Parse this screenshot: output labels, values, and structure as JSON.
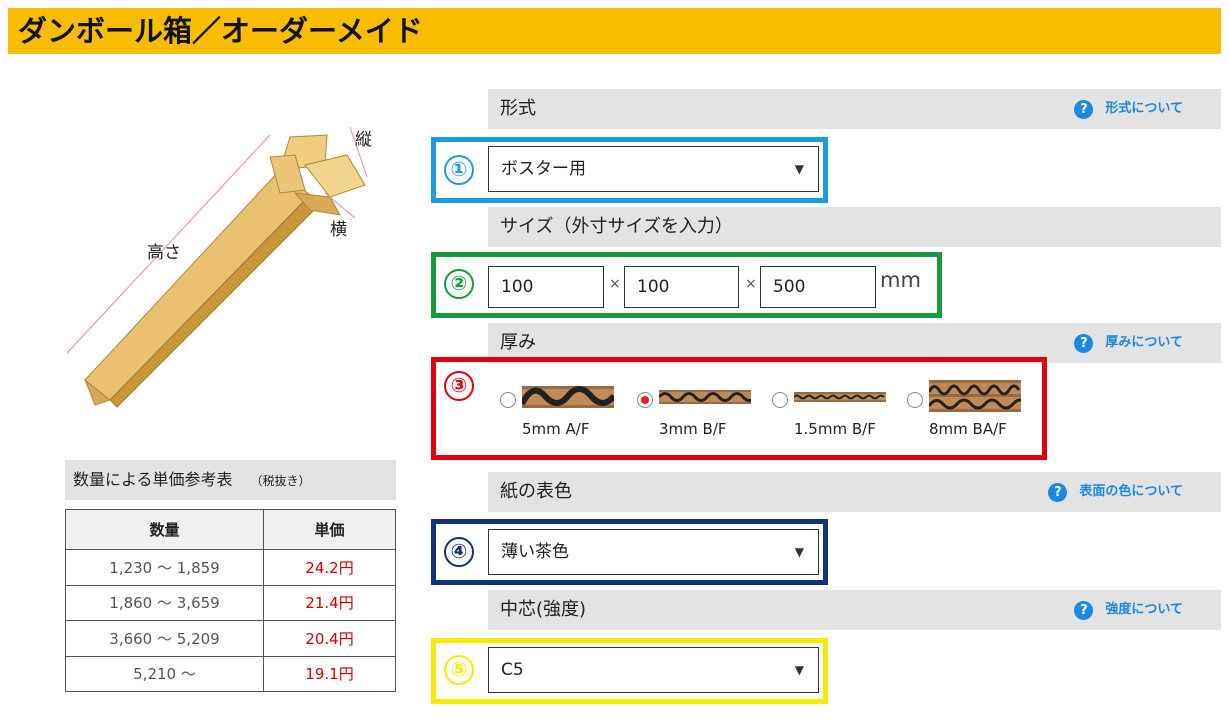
{
  "title": "ダンボール箱／オーダーメイド",
  "illustration": {
    "label_height": "高さ",
    "label_depth": "縦",
    "label_width": "横"
  },
  "price_table": {
    "heading": "数量による単価参考表",
    "note": "（税抜き）",
    "col_qty": "数量",
    "col_price": "単価",
    "rows": [
      {
        "qty": "1,230 ～ 1,859",
        "price": "24.2円"
      },
      {
        "qty": "1,860 ～ 3,659",
        "price": "21.4円"
      },
      {
        "qty": "3,660 ～ 5,209",
        "price": "20.4円"
      },
      {
        "qty": "5,210 ～",
        "price": "19.1円"
      }
    ]
  },
  "sections": {
    "format": {
      "label": "形式",
      "help": "形式について",
      "number": "①",
      "value": "ボスター用"
    },
    "size": {
      "label": "サイズ（外寸サイズを入力）",
      "number": "②",
      "width": "100",
      "depth": "100",
      "height": "500",
      "times": "×",
      "unit": "mm"
    },
    "thickness": {
      "label": "厚み",
      "help": "厚みについて",
      "number": "③",
      "options": [
        {
          "label": "5mm A/F",
          "selected": false
        },
        {
          "label": "3mm B/F",
          "selected": true
        },
        {
          "label": "1.5mm B/F",
          "selected": false
        },
        {
          "label": "8mm BA/F",
          "selected": false
        }
      ]
    },
    "surface_color": {
      "label": "紙の表色",
      "help": "表面の色について",
      "number": "④",
      "value": "薄い茶色"
    },
    "core": {
      "label": "中芯(強度)",
      "help": "強度について",
      "number": "⑤",
      "value": "C5"
    }
  },
  "colors": {
    "accent": "#f8bd00",
    "box1": "#1e9be0",
    "box2": "#159a40",
    "box3": "#e00010",
    "box4": "#14307a",
    "box5": "#f5ea00",
    "help": "#1a8ae0",
    "price": "#cc0000"
  },
  "icons": {
    "help": "question-circle-icon",
    "dropdown": "triangle-down-icon"
  }
}
